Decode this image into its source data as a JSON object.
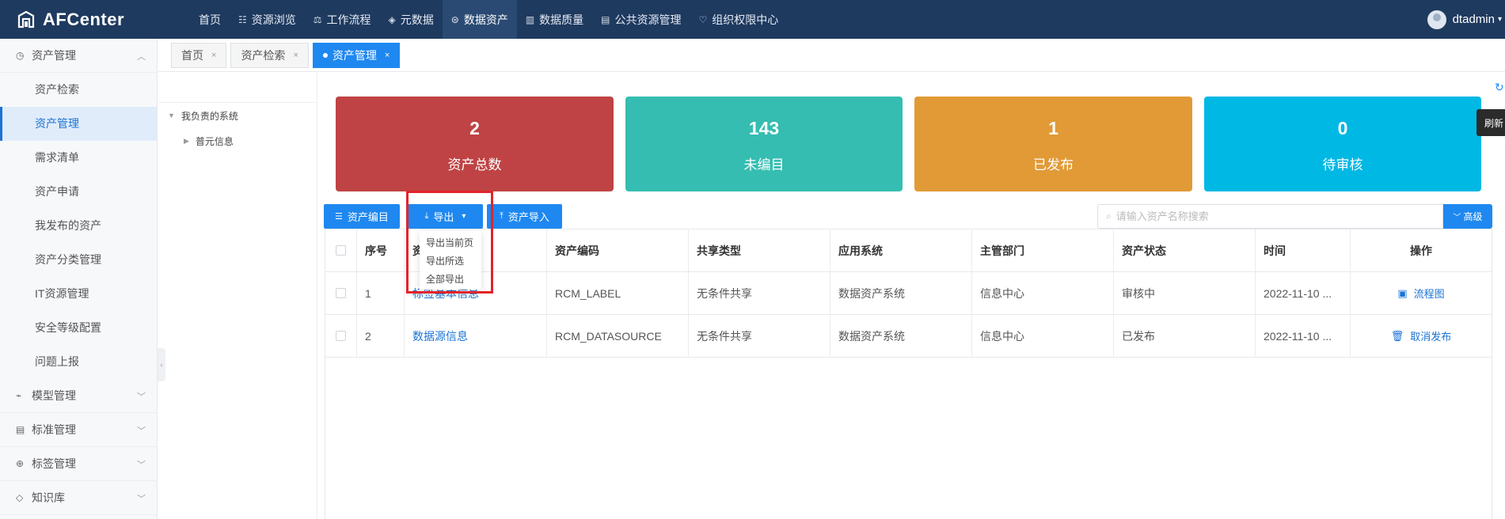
{
  "app": {
    "name": "AFCenter"
  },
  "topnav": [
    {
      "label": "首页",
      "icon": ""
    },
    {
      "label": "资源浏览",
      "icon": "☷"
    },
    {
      "label": "工作流程",
      "icon": "⚖"
    },
    {
      "label": "元数据",
      "icon": "◈"
    },
    {
      "label": "数据资产",
      "icon": "⊜",
      "active": true
    },
    {
      "label": "数据质量",
      "icon": "▥"
    },
    {
      "label": "公共资源管理",
      "icon": "▤"
    },
    {
      "label": "组织权限中心",
      "icon": "♡"
    }
  ],
  "user": {
    "name": "dtadmin"
  },
  "sidebar": {
    "group1": {
      "label": "资产管理",
      "icon": "◷"
    },
    "items": [
      "资产检索",
      "资产管理",
      "需求清单",
      "资产申请",
      "我发布的资产",
      "资产分类管理",
      "IT资源管理",
      "安全等级配置",
      "问题上报"
    ],
    "groups": [
      {
        "label": "模型管理",
        "icon": "⌁"
      },
      {
        "label": "标准管理",
        "icon": "▤"
      },
      {
        "label": "标签管理",
        "icon": "⊕"
      },
      {
        "label": "知识库",
        "icon": "◇"
      }
    ]
  },
  "tabs": [
    {
      "label": "首页"
    },
    {
      "label": "资产检索"
    },
    {
      "label": "资产管理"
    }
  ],
  "tree": {
    "root": "我负责的系统",
    "child": "普元信息"
  },
  "cards": [
    {
      "value": "2",
      "label": "资产总数",
      "color": "#bf4344"
    },
    {
      "value": "143",
      "label": "未编目",
      "color": "#35bdb1"
    },
    {
      "value": "1",
      "label": "已发布",
      "color": "#e19a36"
    },
    {
      "value": "0",
      "label": "待审核",
      "color": "#00b8e4"
    }
  ],
  "refresh_tip": "刷新",
  "toolbar": {
    "catalog": "资产编目",
    "export": "导出",
    "import": "资产导入",
    "search_placeholder": "请输入资产名称搜索",
    "advanced": "高级"
  },
  "export_menu": [
    "导出当前页",
    "导出所选",
    "全部导出"
  ],
  "table": {
    "headers": [
      "序号",
      "资",
      "资产编码",
      "共享类型",
      "应用系统",
      "主管部门",
      "资产状态",
      "时间",
      "操作"
    ],
    "rows": [
      {
        "index": "1",
        "name": "标签基本信息",
        "code": "RCM_LABEL",
        "share": "无条件共享",
        "system": "数据资产系统",
        "dept": "信息中心",
        "status": "审核中",
        "time": "2022-11-10 ...",
        "action": "流程图",
        "action_icon": "flowchart-icon"
      },
      {
        "index": "2",
        "name": "数据源信息",
        "code": "RCM_DATASOURCE",
        "share": "无条件共享",
        "system": "数据资产系统",
        "dept": "信息中心",
        "status": "已发布",
        "time": "2022-11-10 ...",
        "action": "取消发布",
        "action_icon": "trash-icon"
      }
    ]
  }
}
